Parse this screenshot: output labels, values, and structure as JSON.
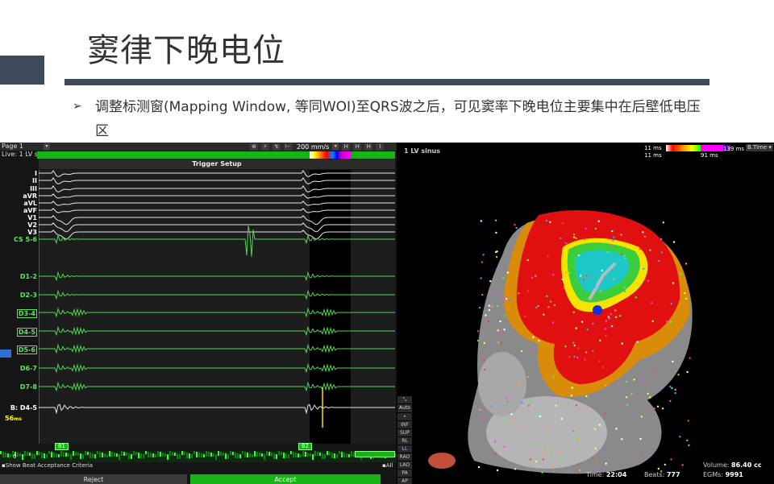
{
  "slide": {
    "title": "窦律下晚电位",
    "bullet": "调整标测窗(Mapping Window, 等同WOI)至QRS波之后，可见窦率下晚电位主要集中在后壁低电压区"
  },
  "egm": {
    "page": "Page 1",
    "live": "Live: 1 LV sinus",
    "speed": "200 mm/s",
    "trigger_title": "Trigger Setup",
    "tool_icons": [
      "zoom-icon",
      "cursor-icon",
      "caliper-icon",
      "marker-icon"
    ],
    "channels": [
      {
        "label": "I",
        "color": "white"
      },
      {
        "label": "II",
        "color": "white"
      },
      {
        "label": "III",
        "color": "white"
      },
      {
        "label": "aVR",
        "color": "white"
      },
      {
        "label": "aVL",
        "color": "white"
      },
      {
        "label": "aVF",
        "color": "white"
      },
      {
        "label": "V1",
        "color": "white"
      },
      {
        "label": "V2",
        "color": "white"
      },
      {
        "label": "V3",
        "color": "white"
      },
      {
        "label": "CS 5-6",
        "color": "green"
      },
      {
        "label": "D1-2",
        "color": "green"
      },
      {
        "label": "D2-3",
        "color": "green"
      },
      {
        "label": "D3-4",
        "color": "green",
        "boxed": true
      },
      {
        "label": "D4-5",
        "color": "green",
        "boxed": true
      },
      {
        "label": "D5-6",
        "color": "green",
        "boxed": true,
        "selected": true
      },
      {
        "label": "D6-7",
        "color": "green"
      },
      {
        "label": "D7-8",
        "color": "green"
      },
      {
        "label": "B: D4-5",
        "color": "white"
      }
    ],
    "b_value": "56",
    "b_unit": "ms",
    "beat_markers": [
      "81",
      "82"
    ],
    "beat_zero": "0",
    "criteria_label": "Show Beat Acceptance Criteria",
    "all_label": "All",
    "reject_label": "Reject",
    "accept_label": "Accept"
  },
  "map": {
    "title": "1 LV sinus",
    "scale_min_top": "11 ms",
    "scale_min_bottom": "11 ms",
    "scale_mid": "91 ms",
    "scale_max": "139 ms",
    "time_mode": "B.Time",
    "view_buttons": [
      "INF",
      "SUP",
      "RL",
      "LL",
      "RAO",
      "LAO",
      "PA",
      "AP"
    ],
    "auto_label": "Auto",
    "time_label": "Time:",
    "time_value": "22:04",
    "beats_label": "Beats:",
    "beats_value": "777",
    "volume_label": "Volume:",
    "volume_value": "86.40 cc",
    "egms_label": "EGMs:",
    "egms_value": "9991"
  }
}
